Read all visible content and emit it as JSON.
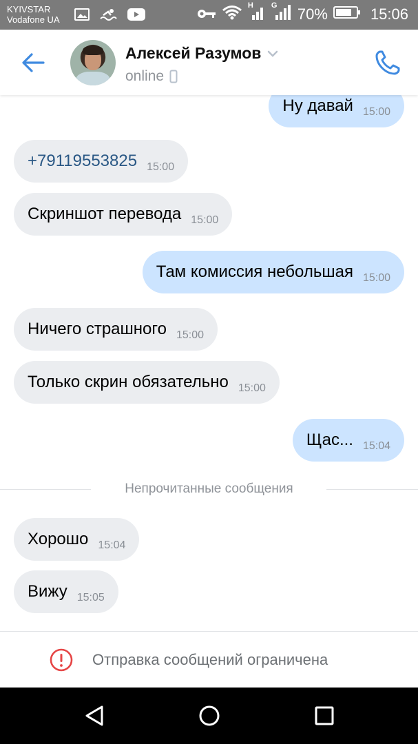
{
  "status_bar": {
    "carrier_1": "KYIVSTAR",
    "carrier_2": "Vodafone UA",
    "signal_1_label": "H",
    "signal_2_label": "G",
    "battery": "70%",
    "time": "15:06"
  },
  "header": {
    "contact_name": "Алексей Разумов",
    "presence": "online"
  },
  "messages": [
    {
      "direction": "out",
      "text": "Ну давай",
      "time": "15:00"
    },
    {
      "direction": "in",
      "text": "+79119553825",
      "time": "15:00",
      "is_link": true
    },
    {
      "direction": "in",
      "text": "Скриншот перевода",
      "time": "15:00"
    },
    {
      "direction": "out",
      "text": "Там комиссия небольшая",
      "time": "15:00"
    },
    {
      "direction": "in",
      "text": "Ничего страшного",
      "time": "15:00"
    },
    {
      "direction": "in",
      "text": "Только скрин обязательно",
      "time": "15:00"
    },
    {
      "direction": "out",
      "text": "Щас...",
      "time": "15:04"
    },
    {
      "direction": "in",
      "text": "Хорошо",
      "time": "15:04"
    },
    {
      "direction": "in",
      "text": "Вижу",
      "time": "15:05"
    }
  ],
  "unread_divider": "Непрочитанные сообщения",
  "footer": {
    "notice": "Отправка сообщений ограничена"
  },
  "colors": {
    "accent": "#3f8ae0",
    "incoming_bubble": "#ebedf0",
    "outgoing_bubble": "#cce4ff",
    "warning": "#e64646"
  },
  "icons": {
    "back": "arrow-left-icon",
    "call": "phone-icon",
    "device": "mobile-device-icon",
    "dropdown": "chevron-down-icon",
    "warning": "exclamation-circle-icon",
    "nav_back": "triangle-back-icon",
    "nav_home": "circle-home-icon",
    "nav_recents": "square-recents-icon"
  }
}
